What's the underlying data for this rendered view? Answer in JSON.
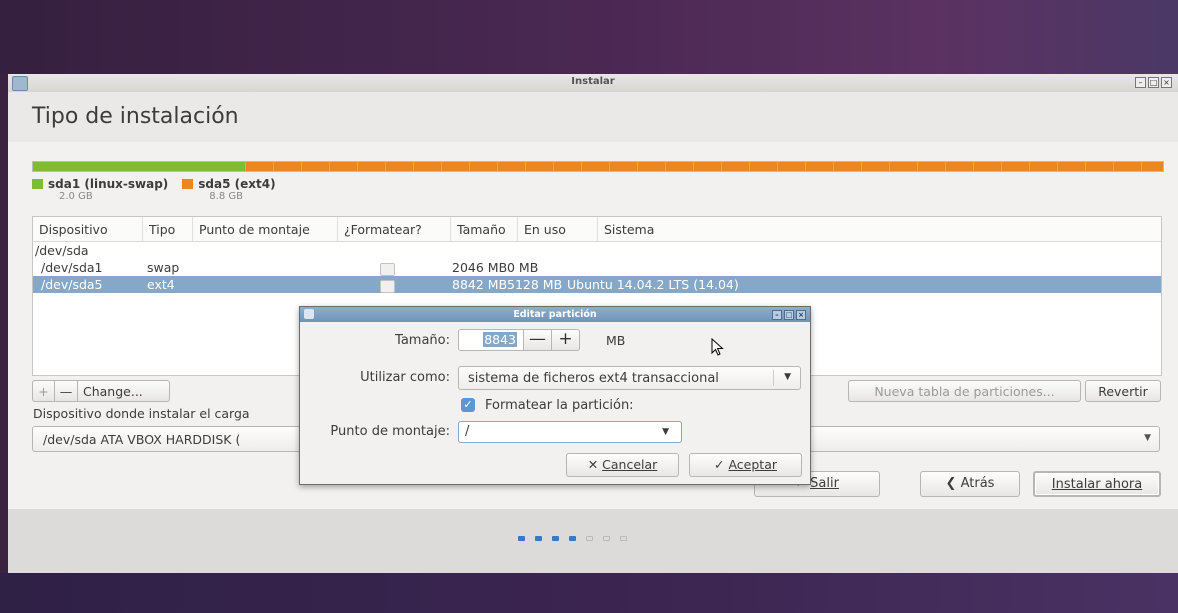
{
  "window": {
    "title": "Instalar",
    "controls": [
      "–",
      "□",
      "×"
    ]
  },
  "page": {
    "heading": "Tipo de instalación"
  },
  "partitions_legend": [
    {
      "name": "sda1 (linux-swap)",
      "size": "2.0 GB",
      "color": "#7dbd36"
    },
    {
      "name": "sda5 (ext4)",
      "size": "8.8 GB",
      "color": "#e98722"
    }
  ],
  "table": {
    "headers": [
      "Dispositivo",
      "Tipo",
      "Punto de montaje",
      "¿Formatear?",
      "Tamaño",
      "En uso",
      "Sistema"
    ],
    "rows": [
      {
        "device": "/dev/sda",
        "type": "",
        "mount": "",
        "format": "",
        "size": "",
        "used": "",
        "system": ""
      },
      {
        "device": "/dev/sda1",
        "type": "swap",
        "mount": "",
        "format": "checkbox",
        "size": "2046 MB",
        "used": "0 MB",
        "system": ""
      },
      {
        "device": "/dev/sda5",
        "type": "ext4",
        "mount": "",
        "format": "checkbox",
        "size": "8842 MB",
        "used": "5128 MB",
        "system": "Ubuntu 14.04.2 LTS (14.04)"
      }
    ]
  },
  "toolbar": {
    "add": "+",
    "remove": "—",
    "change": "Change...",
    "new_table": "Nueva tabla de particiones...",
    "revert": "Revertir"
  },
  "bootloader": {
    "label": "Dispositivo donde instalar el carga",
    "value": "/dev/sda   ATA VBOX HARDDISK ("
  },
  "nav": {
    "quit": "Salir",
    "back": "Atrás",
    "install": "Instalar ahora"
  },
  "progress_dots": {
    "total": 7,
    "done": 4
  },
  "dialog": {
    "title": "Editar partición",
    "size_label": "Tamaño:",
    "size_value": "8843",
    "size_unit": "MB",
    "minus": "—",
    "plus": "+",
    "use_as_label": "Utilizar como:",
    "use_as_value": "sistema de ficheros ext4 transaccional",
    "format_label": "Formatear la partición:",
    "format_checked": true,
    "mount_label": "Punto de montaje:",
    "mount_value": "/",
    "cancel": "Cancelar",
    "ok": "Aceptar"
  }
}
